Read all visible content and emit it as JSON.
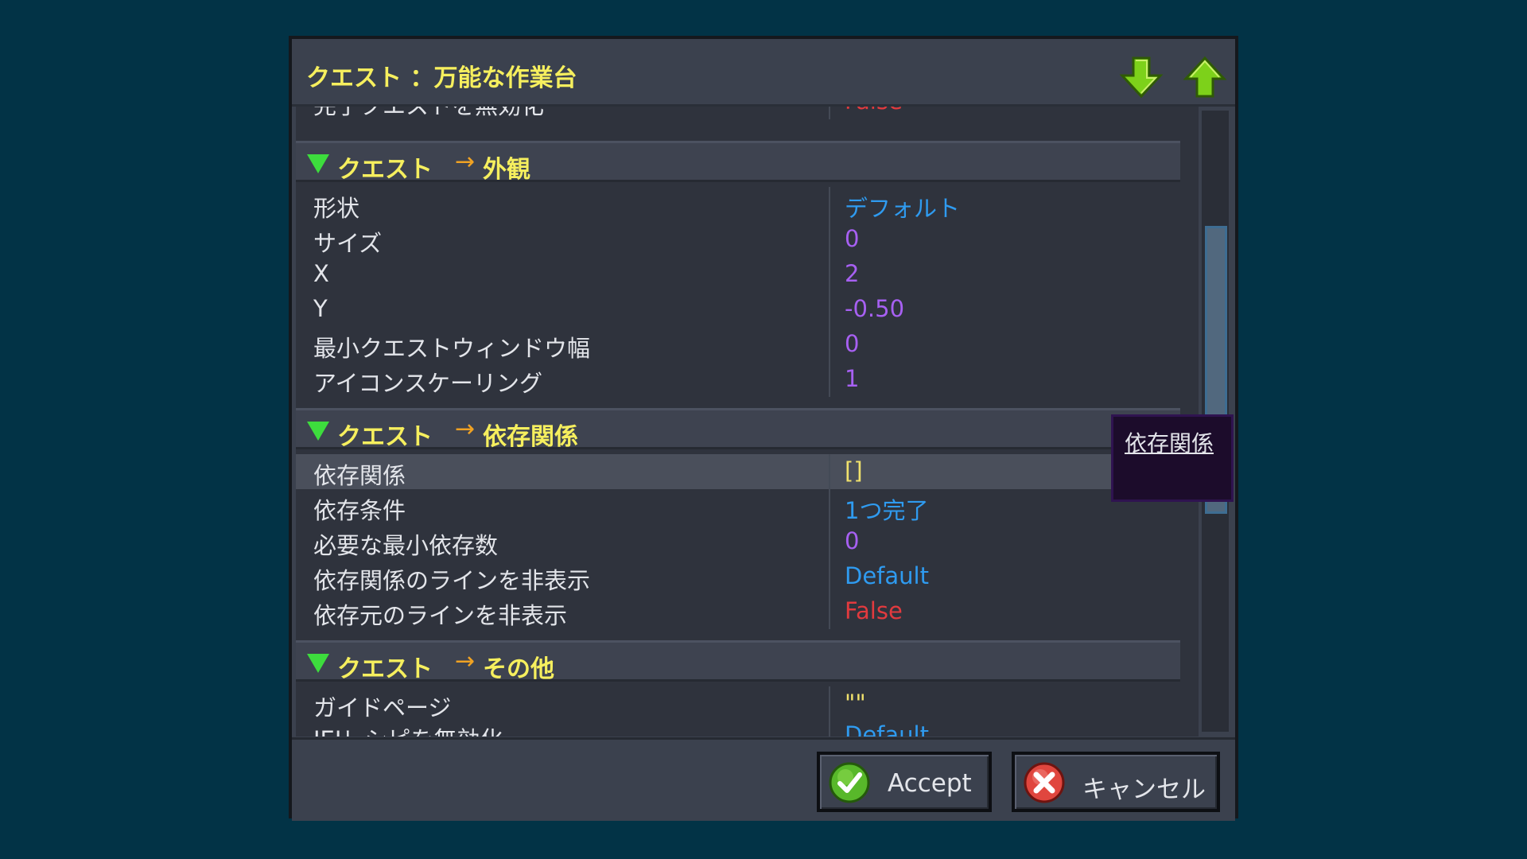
{
  "dialog": {
    "title": "クエスト ：万能な作業台",
    "move_down_icon": "arrow-down-icon",
    "move_up_icon": "arrow-up-icon"
  },
  "clipped_row": {
    "key": "完了クエストを無効化",
    "value": "False",
    "value_color": "#e23a3e"
  },
  "sections": [
    {
      "label": "クエスト",
      "arrow": "→",
      "sub": "外観",
      "rows": [
        {
          "key": "形状",
          "value": "デフォルト",
          "value_color": "#2f9bf0"
        },
        {
          "key": "サイズ",
          "value": "0",
          "value_color": "#a760f2"
        },
        {
          "key": "X",
          "value": "2",
          "value_color": "#a760f2"
        },
        {
          "key": "Y",
          "value": "-0.50",
          "value_color": "#a760f2"
        },
        {
          "key": "最小クエストウィンドウ幅",
          "value": "0",
          "value_color": "#a760f2"
        },
        {
          "key": "アイコンスケーリング",
          "value": "1",
          "value_color": "#a760f2"
        }
      ]
    },
    {
      "label": "クエスト",
      "arrow": "→",
      "sub": "依存関係",
      "rows": [
        {
          "key": "依存関係",
          "value": "[]",
          "value_color": "#f0e16c"
        },
        {
          "key": "依存条件",
          "value": "1つ完了",
          "value_color": "#2f9bf0"
        },
        {
          "key": "必要な最小依存数",
          "value": "0",
          "value_color": "#a760f2"
        },
        {
          "key": "依存関係のラインを非表示",
          "value": "Default",
          "value_color": "#2f9bf0"
        },
        {
          "key": "依存元のラインを非表示",
          "value": "False",
          "value_color": "#e23a3e"
        }
      ]
    },
    {
      "label": "クエスト",
      "arrow": "→",
      "sub": "その他",
      "rows": [
        {
          "key": "ガイドページ",
          "value": "\"\"",
          "value_color": "#f0e16c"
        },
        {
          "key": "JEIレシピを無効化",
          "value": "Default",
          "value_color": "#2f9bf0"
        }
      ]
    }
  ],
  "tooltip": {
    "text": "依存関係"
  },
  "footer": {
    "accept_label": "Accept",
    "accept_icon": "check-icon",
    "cancel_label": "キャンセル",
    "cancel_icon": "close-icon"
  }
}
